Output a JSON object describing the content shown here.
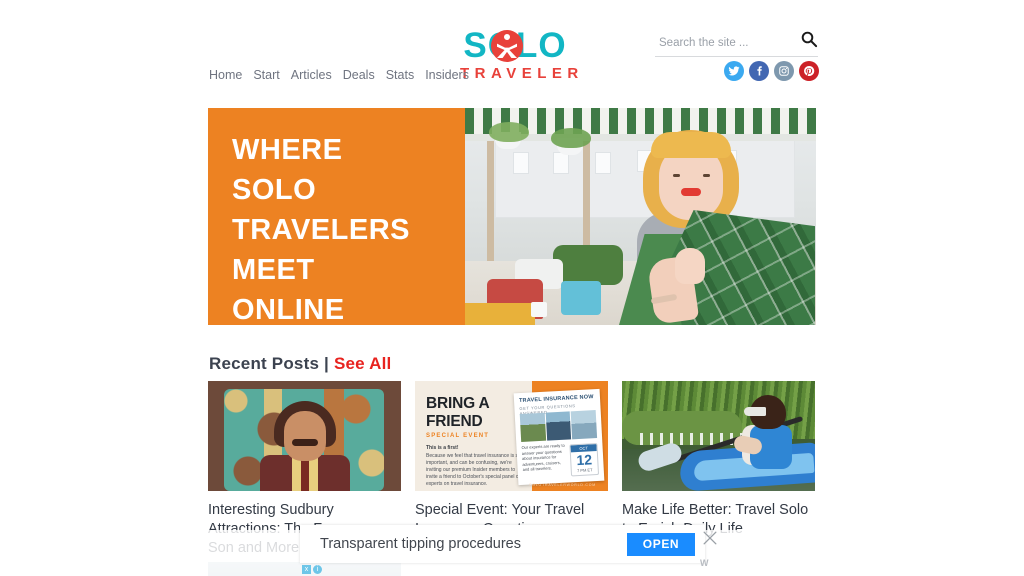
{
  "site": {
    "logo_top": "SOLO",
    "logo_bottom": "TRAVELER",
    "logo_colors": {
      "solo": "#12B6C4",
      "traveler": "#E8413A",
      "mark": "#E8413A"
    }
  },
  "nav": {
    "items": [
      {
        "label": "Home"
      },
      {
        "label": "Start"
      },
      {
        "label": "Articles"
      },
      {
        "label": "Deals"
      },
      {
        "label": "Stats"
      },
      {
        "label": "Insiders"
      }
    ]
  },
  "search": {
    "placeholder": "Search the site ...",
    "value": "",
    "icon": "search-icon"
  },
  "socials": [
    {
      "name": "twitter",
      "glyph": "t",
      "color": "#3BA9F0"
    },
    {
      "name": "facebook",
      "glyph": "f",
      "color": "#4267B2"
    },
    {
      "name": "instagram",
      "glyph": "i",
      "color": "#7E98AE"
    },
    {
      "name": "pinterest",
      "glyph": "p",
      "color": "#CC2127"
    }
  ],
  "hero": {
    "line1": "WHERE",
    "line2": "SOLO",
    "line3": "TRAVELERS",
    "line4": "MEET",
    "line5": "ONLINE",
    "bg_color": "#ED8222",
    "image_alt": "Woman wrapped in a green plaid blanket at an outdoor cafe"
  },
  "recent": {
    "heading": "Recent Posts",
    "separator": "|",
    "see_all": "See All",
    "see_all_color": "#E8231F"
  },
  "posts": [
    {
      "title_line1": "Interesting Sudbury",
      "title_line2": "Attractions: The Famous",
      "title_line3": "Son and More",
      "thumb_alt": "Mural of a smiling man with a moustache on a retro geometric background"
    },
    {
      "title_line1": "Special Event: Your Travel",
      "title_line2": "Insurance Questions",
      "title_line3": "",
      "thumb_alt": "Bring A Friend special event flyer",
      "flyer": {
        "headline_line1": "BRING A",
        "headline_line2": "FRIEND",
        "subhead": "SPECIAL EVENT",
        "lead": "This is a first!",
        "body": "Because we feel that travel insurance is so important, and can be confusing, we're inviting our premium Insider members to invite a friend to October's special panel of experts on travel insurance.",
        "card_headline": "TRAVEL INSURANCE NOW",
        "card_subhead": "GET YOUR QUESTIONS ANSWERED",
        "card_body": "Our experts are ready to answer your questions about insurance for adventurers, cruisers, and all travelers.",
        "calendar_month": "OCT",
        "calendar_day": "12",
        "calendar_time": "7 PM ET",
        "footer": "SOLOTRAVELERWORLD.COM"
      }
    },
    {
      "title_line1": "Make Life Better: Travel Solo",
      "title_line2": "to Enrich Daily Life",
      "title_line3": "",
      "thumb_alt": "Woman kayaking on a green river"
    }
  ],
  "ad": {
    "text": "Transparent tipping procedures",
    "button_label": "OPEN",
    "button_color": "#1A8CFF",
    "close_icon": "close-icon",
    "network_logo": "W",
    "adchoices": [
      "x",
      "i"
    ]
  }
}
